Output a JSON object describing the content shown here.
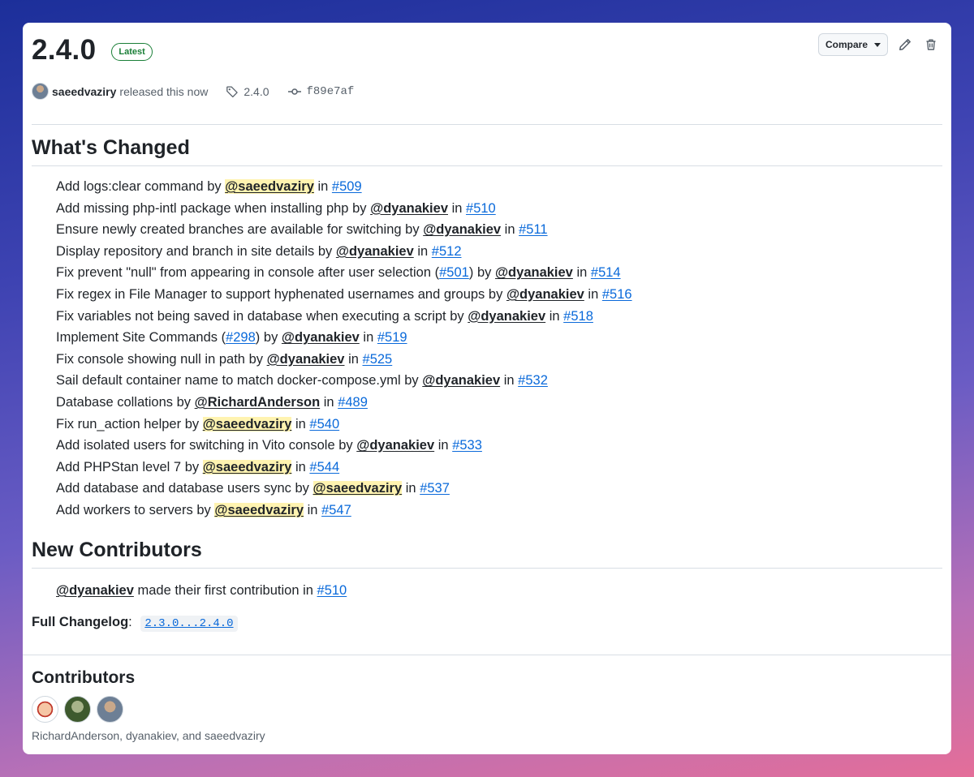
{
  "release": {
    "version": "2.4.0",
    "badge": "Latest",
    "author": "saeedvaziry",
    "released_text": "released this now",
    "tag": "2.4.0",
    "commit": "f89e7af",
    "compare_label": "Compare"
  },
  "whats_changed": {
    "heading": "What's Changed",
    "items": [
      {
        "text": "Add logs:clear command",
        "pre": "",
        "ref": "",
        "post": "",
        "by": "@saeedvaziry",
        "pr": "#509"
      },
      {
        "text": "Add missing php-intl package when installing php",
        "pre": "",
        "ref": "",
        "post": "",
        "by": "@dyanakiev",
        "pr": "#510"
      },
      {
        "text": "Ensure newly created branches are available for switching",
        "pre": "",
        "ref": "",
        "post": "",
        "by": "@dyanakiev",
        "pr": "#511"
      },
      {
        "text": "Display repository and branch in site details",
        "pre": "",
        "ref": "",
        "post": "",
        "by": "@dyanakiev",
        "pr": "#512"
      },
      {
        "text": "",
        "pre": "Fix prevent \"null\" from appearing in console after user selection (",
        "ref": "#501",
        "post": ")",
        "by": "@dyanakiev",
        "pr": "#514"
      },
      {
        "text": "Fix regex in File Manager to support hyphenated usernames and groups",
        "pre": "",
        "ref": "",
        "post": "",
        "by": "@dyanakiev",
        "pr": "#516"
      },
      {
        "text": "Fix variables not being saved in database when executing a script",
        "pre": "",
        "ref": "",
        "post": "",
        "by": "@dyanakiev",
        "pr": "#518"
      },
      {
        "text": "",
        "pre": "Implement Site Commands (",
        "ref": "#298",
        "post": ")",
        "by": "@dyanakiev",
        "pr": "#519"
      },
      {
        "text": "Fix console showing null in path",
        "pre": "",
        "ref": "",
        "post": "",
        "by": "@dyanakiev",
        "pr": "#525"
      },
      {
        "text": "Sail default container name to match docker-compose.yml",
        "pre": "",
        "ref": "",
        "post": "",
        "by": "@dyanakiev",
        "pr": "#532"
      },
      {
        "text": "Database collations",
        "pre": "",
        "ref": "",
        "post": "",
        "by": "@RichardAnderson",
        "pr": "#489"
      },
      {
        "text": "Fix run_action helper",
        "pre": "",
        "ref": "",
        "post": "",
        "by": "@saeedvaziry",
        "pr": "#540"
      },
      {
        "text": "Add isolated users for switching in Vito console",
        "pre": "",
        "ref": "",
        "post": "",
        "by": "@dyanakiev",
        "pr": "#533"
      },
      {
        "text": "Add PHPStan level 7",
        "pre": "",
        "ref": "",
        "post": "",
        "by": "@saeedvaziry",
        "pr": "#544"
      },
      {
        "text": "Add database and database users sync",
        "pre": "",
        "ref": "",
        "post": "",
        "by": "@saeedvaziry",
        "pr": "#537"
      },
      {
        "text": "Add workers to servers",
        "pre": "",
        "ref": "",
        "post": "",
        "by": "@saeedvaziry",
        "pr": "#547"
      }
    ]
  },
  "new_contributors": {
    "heading": "New Contributors",
    "user": "@dyanakiev",
    "text": "made their first contribution in",
    "pr": "#510"
  },
  "changelog": {
    "label": "Full Changelog",
    "link": "2.3.0...2.4.0"
  },
  "contributors": {
    "heading": "Contributors",
    "names": "RichardAnderson, dyanakiev, and saeedvaziry",
    "avatars": [
      "RichardAnderson",
      "dyanakiev",
      "saeedvaziry"
    ]
  },
  "words": {
    "by": "by",
    "in": "in",
    "colon": ":"
  },
  "colors": {
    "link": "#0969da",
    "latest": "#1a7f37",
    "self_mention_highlight": "#fff3b0"
  },
  "icons": [
    "edit-icon",
    "trash-icon",
    "tag-icon",
    "commit-icon",
    "caret-down-icon"
  ]
}
